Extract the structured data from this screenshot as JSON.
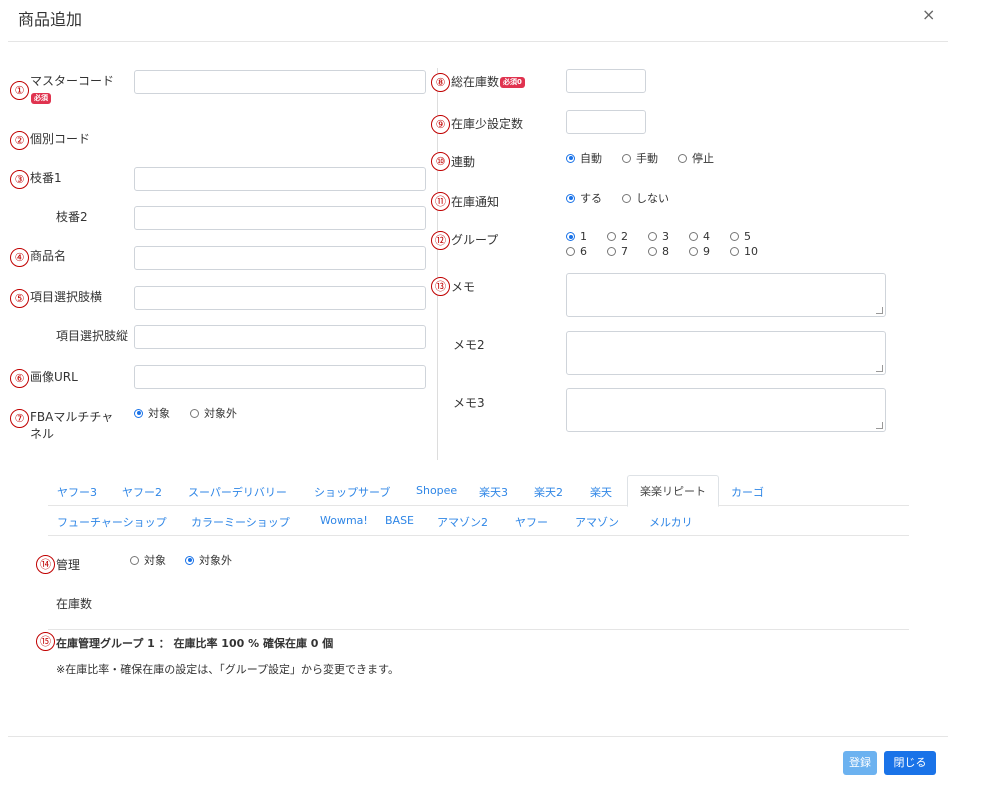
{
  "header": {
    "title": "商品追加",
    "close_label": "×"
  },
  "markers": [
    "①",
    "②",
    "③",
    "④",
    "⑤",
    "⑥",
    "⑦",
    "⑧",
    "⑨",
    "⑩",
    "⑪",
    "⑫",
    "⑬",
    "⑭",
    "⑮"
  ],
  "left": {
    "master_code": {
      "label": "マスターコード",
      "badge": "必須",
      "value": ""
    },
    "individual_code": {
      "label": "個別コード"
    },
    "branch1": {
      "label": "枝番1",
      "value": ""
    },
    "branch2": {
      "label": "枝番2",
      "value": ""
    },
    "product_name": {
      "label": "商品名",
      "value": ""
    },
    "choice_h": {
      "label": "項目選択肢横",
      "value": ""
    },
    "choice_v": {
      "label": "項目選択肢縦",
      "value": ""
    },
    "image_url": {
      "label": "画像URL",
      "value": ""
    },
    "fba": {
      "label": "FBAマルチチャネル",
      "options": [
        "対象",
        "対象外"
      ],
      "selected": 0
    }
  },
  "right": {
    "total_stock": {
      "label": "総在庫数",
      "badge": "必須0",
      "value": ""
    },
    "low_stock": {
      "label": "在庫少設定数",
      "value": ""
    },
    "link": {
      "label": "連動",
      "options": [
        "自動",
        "手動",
        "停止"
      ],
      "selected": 0
    },
    "stock_notice": {
      "label": "在庫通知",
      "options": [
        "する",
        "しない"
      ],
      "selected": 0
    },
    "group": {
      "label": "グループ",
      "options": [
        "1",
        "2",
        "3",
        "4",
        "5",
        "6",
        "7",
        "8",
        "9",
        "10"
      ],
      "selected": 0
    },
    "memo": {
      "label": "メモ",
      "value": ""
    },
    "memo2": {
      "label": "メモ2",
      "value": ""
    },
    "memo3": {
      "label": "メモ3",
      "value": ""
    }
  },
  "tabs": {
    "row1": [
      "ヤフー3",
      "ヤフー2",
      "スーパーデリバリー",
      "ショップサーブ",
      "Shopee",
      "楽天3",
      "楽天2",
      "楽天",
      "楽楽リピート",
      "カーゴ"
    ],
    "row2": [
      "フューチャーショップ",
      "カラーミーショップ",
      "Wowma!",
      "BASE",
      "アマゾン2",
      "ヤフー",
      "アマゾン",
      "メルカリ"
    ],
    "active": "楽楽リピート"
  },
  "tab_panel": {
    "manage": {
      "label": "管理",
      "options": [
        "対象",
        "対象外"
      ],
      "selected": 1
    },
    "stock_label": "在庫数",
    "group_info": "在庫管理グループ 1 ： 在庫比率 100 % 確保在庫 0 個",
    "group_note": "※在庫比率・確保在庫の設定は、「グループ設定」から変更できます。"
  },
  "footer": {
    "register_label": "登録",
    "close_label": "閉じる"
  },
  "colors": {
    "accent": "#1a73e8",
    "register": "#6cb2f0",
    "badge": "#e0334f",
    "marker": "#c00000"
  }
}
